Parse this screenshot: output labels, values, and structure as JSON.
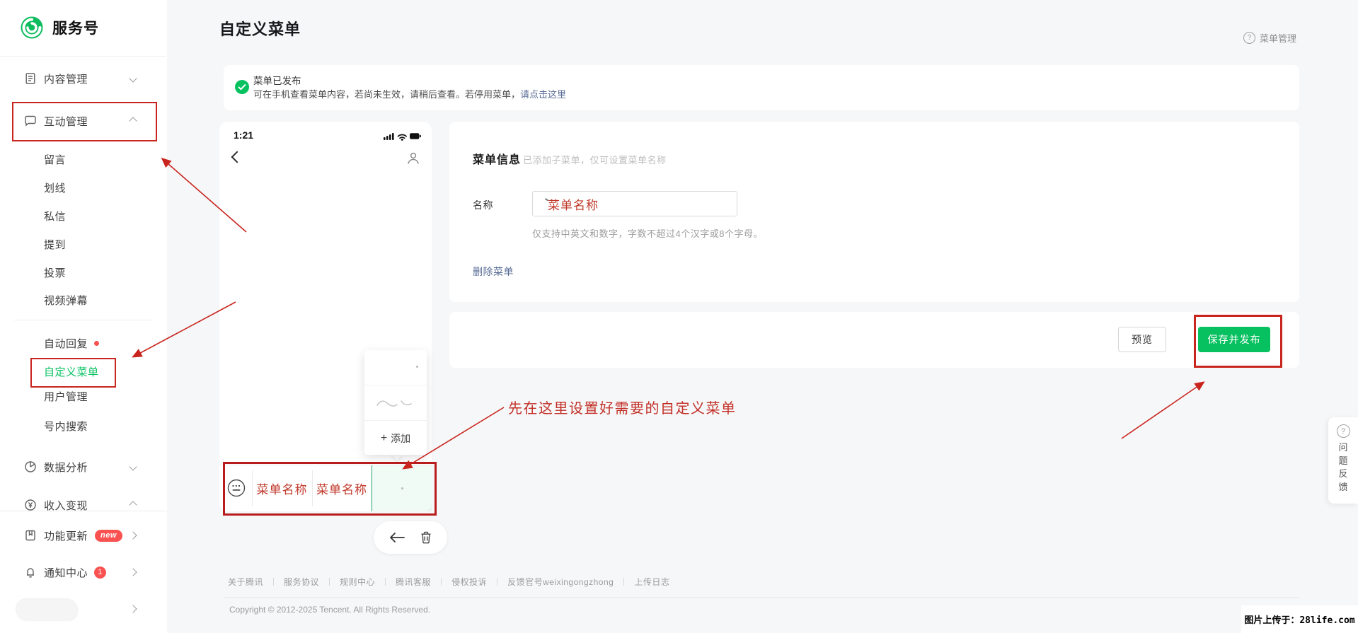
{
  "brand": {
    "name": "服务号"
  },
  "header": {
    "title": "自定义菜单",
    "help_label": "菜单管理",
    "help_icon": "?"
  },
  "sidebar": {
    "content_mgmt": "内容管理",
    "interact_mgmt": "互动管理",
    "sub_items": [
      "留言",
      "划线",
      "私信",
      "提到",
      "投票",
      "视频弹幕"
    ],
    "sub_items2": [
      "自动回复",
      "自定义菜单",
      "用户管理",
      "号内搜索"
    ],
    "data_analysis": "数据分析",
    "income": "收入变现",
    "feature_update": "功能更新",
    "feature_badge": "new",
    "notify": "通知中心",
    "notify_badge": "1"
  },
  "banner": {
    "title": "菜单已发布",
    "body": "可在手机查看菜单内容，若尚未生效，请稍后查看。若停用菜单，",
    "link": "请点击这里"
  },
  "phone": {
    "time": "1:21",
    "menu_items": [
      "菜单名称",
      "菜单名称"
    ],
    "add_plus": "+",
    "add_label": "添加"
  },
  "form": {
    "section_title": "菜单信息",
    "section_note": "已添加子菜单，仅可设置菜单名称",
    "name_label": "名称",
    "name_value": "菜单名称",
    "helper": "仅支持中英文和数字，字数不超过4个汉字或8个字母。",
    "delete_link": "删除菜单"
  },
  "actions": {
    "preview": "预览",
    "save": "保存并发布"
  },
  "annotation": {
    "note": "先在这里设置好需要的自定义菜单"
  },
  "footer": {
    "links": [
      "关于腾讯",
      "服务协议",
      "规则中心",
      "腾讯客服",
      "侵权投诉",
      "反馈官号weixingongzhong",
      "上传日志"
    ],
    "copyright": "Copyright © 2012-2025 Tencent. All Rights Reserved."
  },
  "feedback": {
    "label": "问题反馈",
    "icon": "?"
  },
  "watermark": {
    "text": "图片上传于：28life.com"
  },
  "colors": {
    "brand_green": "#07c160",
    "annotation_red": "#c9251f",
    "link_blue": "#576b95",
    "badge_red": "#fa5151"
  }
}
